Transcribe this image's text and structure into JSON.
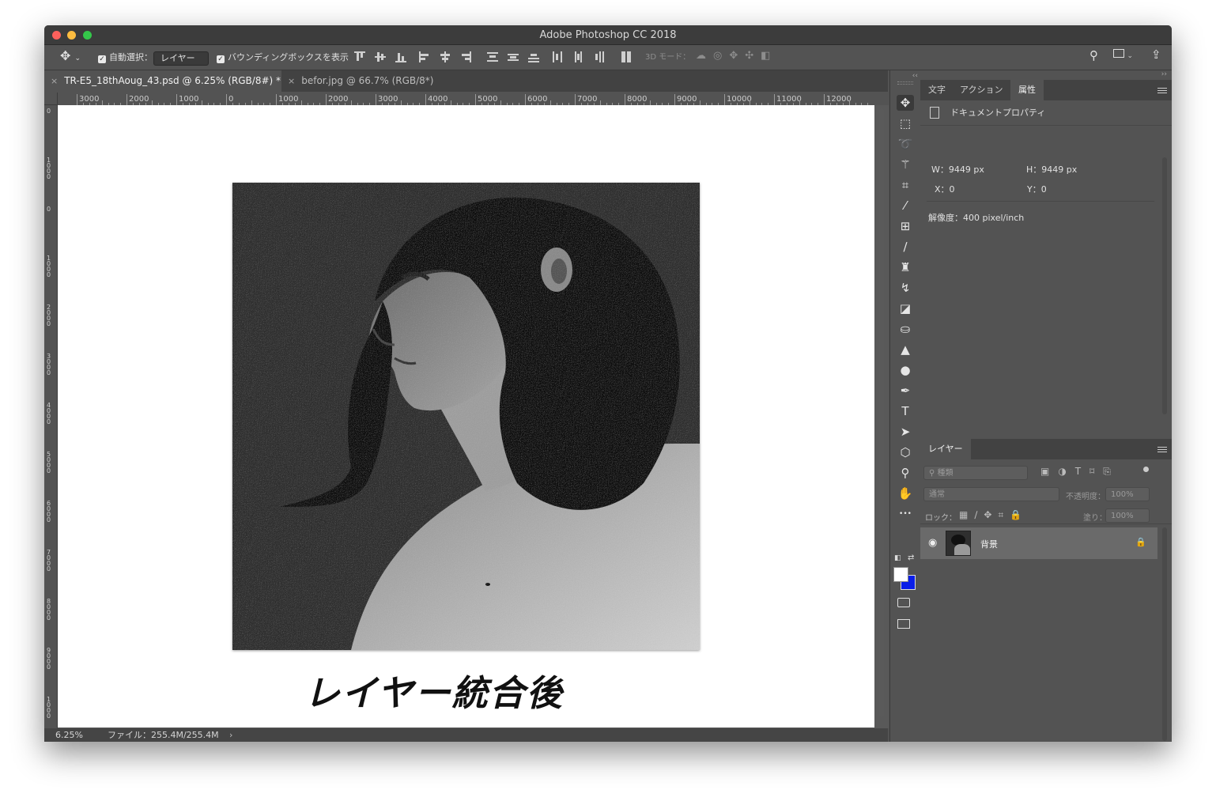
{
  "window": {
    "title": "Adobe Photoshop CC 2018"
  },
  "options": {
    "auto_select_label": "自動選択：",
    "auto_select_value": "レイヤー",
    "bbox_label": "バウンディングボックスを表示",
    "mode_3d_label": "3D モード："
  },
  "tabs": [
    {
      "label": "TR-E5_18thAoug_43.psd @ 6.25% (RGB/8#) *"
    },
    {
      "label": "befor.jpg @ 66.7% (RGB/8*)"
    }
  ],
  "ruler": {
    "h_labels": [
      "3000",
      "2000",
      "1000",
      "0",
      "1000",
      "2000",
      "3000",
      "4000",
      "5000",
      "6000",
      "7000",
      "8000",
      "9000",
      "10000",
      "11000",
      "12000"
    ],
    "v_labels": [
      "0",
      "1000",
      "0",
      "1000",
      "2000",
      "3000",
      "4000",
      "5000",
      "6000",
      "7000",
      "8000",
      "9000",
      "1000"
    ]
  },
  "document": {
    "caption": "レイヤー統合後"
  },
  "status": {
    "zoom": "6.25%",
    "file_info": "ファイル：255.4M/255.4M"
  },
  "tools": [
    {
      "name": "move-tool-icon",
      "glyph": "✥"
    },
    {
      "name": "marquee-tool-icon",
      "glyph": "⬚"
    },
    {
      "name": "lasso-tool-icon",
      "glyph": "➰"
    },
    {
      "name": "magic-wand-tool-icon",
      "glyph": "⚚"
    },
    {
      "name": "crop-tool-icon",
      "glyph": "⌗"
    },
    {
      "name": "eyedropper-tool-icon",
      "glyph": "⁄"
    },
    {
      "name": "healing-tool-icon",
      "glyph": "⊞"
    },
    {
      "name": "brush-tool-icon",
      "glyph": "∕"
    },
    {
      "name": "stamp-tool-icon",
      "glyph": "♜"
    },
    {
      "name": "history-brush-tool-icon",
      "glyph": "↯"
    },
    {
      "name": "eraser-tool-icon",
      "glyph": "◪"
    },
    {
      "name": "paint-bucket-tool-icon",
      "glyph": "⛀"
    },
    {
      "name": "blur-tool-icon",
      "glyph": "▲"
    },
    {
      "name": "dodge-tool-icon",
      "glyph": "●"
    },
    {
      "name": "pen-tool-icon",
      "glyph": "✒"
    },
    {
      "name": "type-tool-icon",
      "glyph": "T"
    },
    {
      "name": "path-select-tool-icon",
      "glyph": "➤"
    },
    {
      "name": "shape-tool-icon",
      "glyph": "⬡"
    },
    {
      "name": "zoom-tool-icon",
      "glyph": "⚲"
    },
    {
      "name": "hand-tool-icon",
      "glyph": "✋"
    },
    {
      "name": "more-tools-icon",
      "glyph": "•••"
    }
  ],
  "panels": {
    "tabs": [
      "文字",
      "アクション",
      "属性"
    ],
    "properties": {
      "heading": "ドキュメントプロパティ",
      "w": "W：9449 px",
      "h": "H：9449 px",
      "x": "X：0",
      "y": "Y：0",
      "resolution": "解像度：400 pixel/inch"
    },
    "layers": {
      "tab": "レイヤー",
      "filter_placeholder": "種類",
      "blend_mode": "通常",
      "opacity_label": "不透明度：",
      "opacity_value": "100%",
      "lock_label": "ロック：",
      "fill_label": "塗り：",
      "fill_value": "100%",
      "items": [
        {
          "name": "背景"
        }
      ]
    }
  }
}
